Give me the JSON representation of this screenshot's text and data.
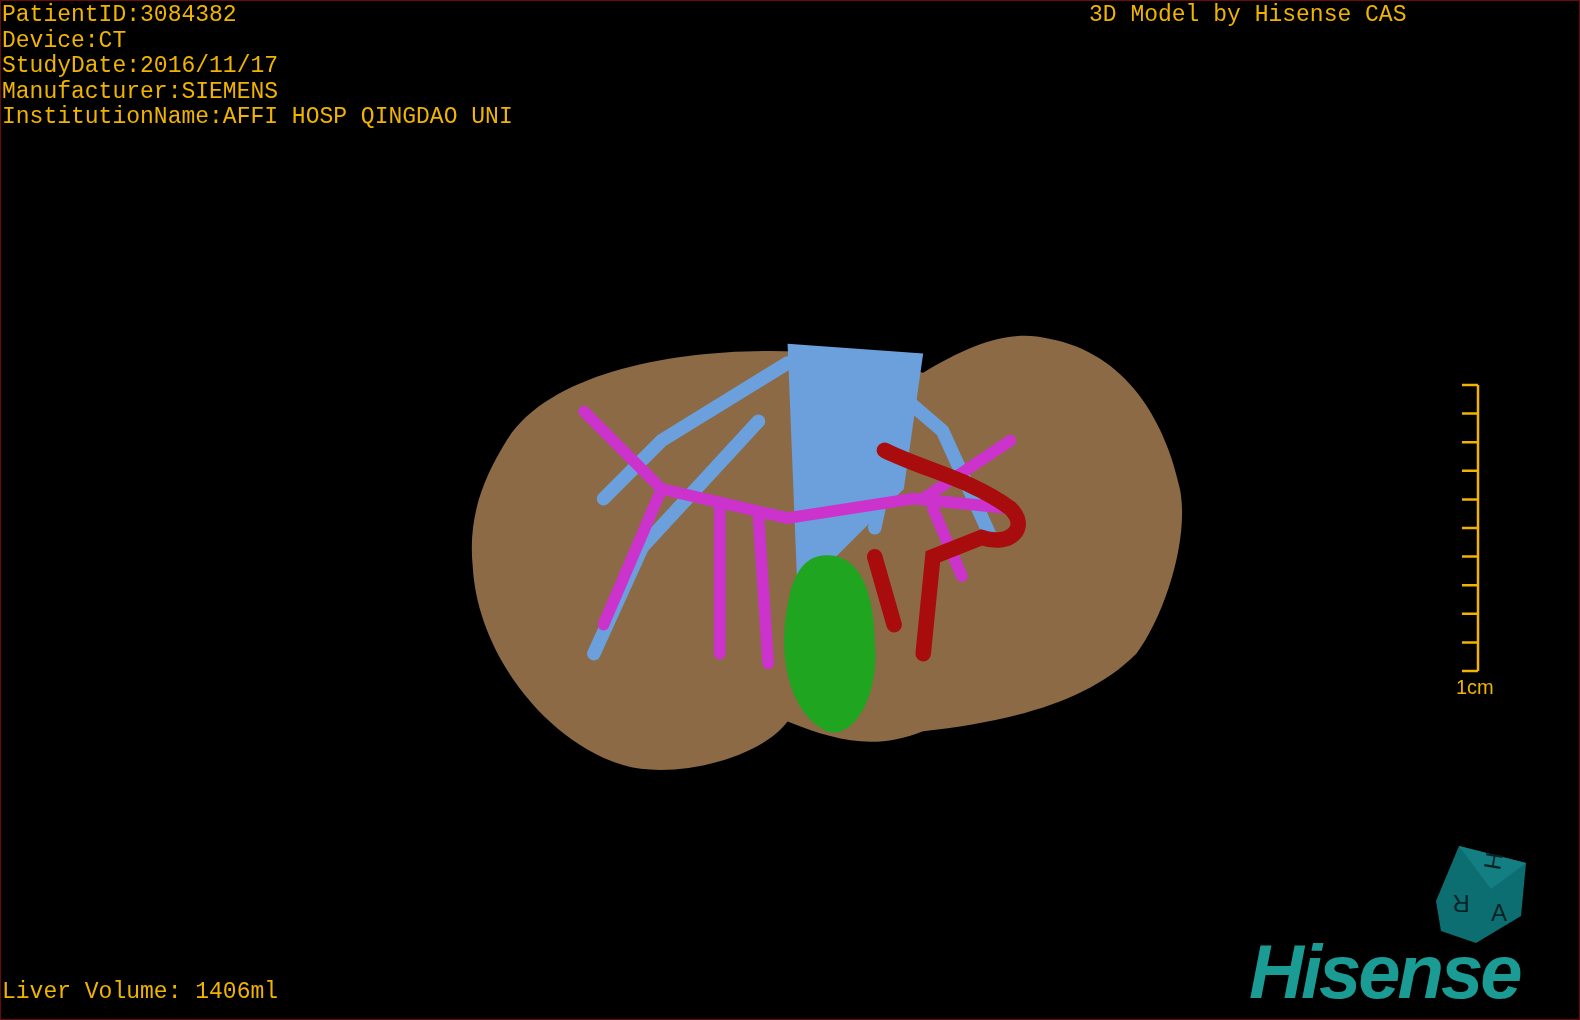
{
  "study_info": [
    "PatientID:3084382",
    "Device:CT",
    "StudyDate:2016/11/17",
    "Manufacturer:SIEMENS",
    "InstitutionName:AFFI HOSP QINGDAO UNI"
  ],
  "model_credit": "3D Model by Hisense CAS",
  "scale_bar": {
    "label": "1cm"
  },
  "orientation_cube": {
    "faces": [
      "H",
      "A",
      "R"
    ]
  },
  "liver_volume": "Liver Volume: 1406ml",
  "logo": "Hisense"
}
